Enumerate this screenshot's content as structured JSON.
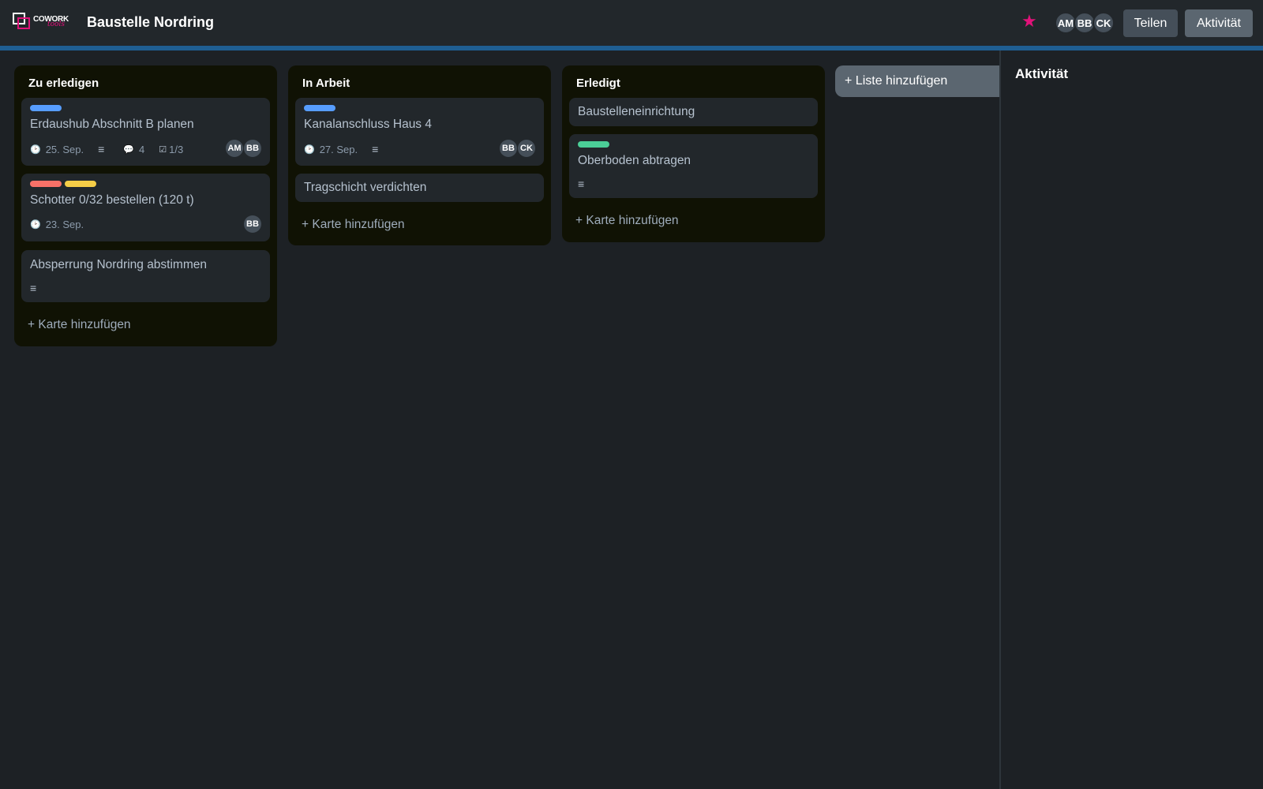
{
  "header": {
    "logo_text": "COWORK",
    "logo_sub": "tools",
    "board_title": "Baustelle Nordring",
    "star_icon": "star-icon",
    "members": [
      "AM",
      "BB",
      "CK"
    ],
    "share_label": "Teilen",
    "activity_label": "Aktivität"
  },
  "colors": {
    "accent": "#e2127a",
    "stripe": "#1f5e92",
    "label_blue": "#579dff",
    "label_red": "#f87168",
    "label_yellow": "#f5cd47",
    "label_green": "#4bce97"
  },
  "lists": [
    {
      "title": "Zu erledigen",
      "cards": [
        {
          "title": "Erdaushub Abschnitt B planen",
          "labels": [
            "blue"
          ],
          "due": "25. Sep.",
          "has_description": true,
          "comments": "4",
          "checklist": "1/3",
          "members": [
            "AM",
            "BB"
          ]
        },
        {
          "title": "Schotter 0/32 bestellen (120 t)",
          "labels": [
            "red",
            "yellow"
          ],
          "due": "23. Sep.",
          "members": [
            "BB"
          ]
        },
        {
          "title": "Absperrung Nordring abstimmen",
          "has_description": true
        }
      ],
      "add_card": "+ Karte hinzufügen"
    },
    {
      "title": "In Arbeit",
      "cards": [
        {
          "title": "Kanalanschluss Haus 4",
          "labels": [
            "blue"
          ],
          "due": "27. Sep.",
          "has_description": true,
          "members": [
            "BB",
            "CK"
          ]
        },
        {
          "title": "Tragschicht verdichten"
        }
      ],
      "add_card": "+ Karte hinzufügen"
    },
    {
      "title": "Erledigt",
      "cards": [
        {
          "title": "Baustelleneinrichtung"
        },
        {
          "title": "Oberboden abtragen",
          "labels": [
            "green"
          ],
          "has_description": true
        }
      ],
      "add_card": "+ Karte hinzufügen"
    }
  ],
  "add_list": "+ Liste hinzufügen",
  "activity_panel": {
    "title": "Aktivität"
  },
  "icons": {
    "clock": "clock-icon",
    "description": "description-icon",
    "comment": "comment-icon",
    "checklist": "checklist-icon"
  },
  "glyphs": {
    "clock": "🕑",
    "description": "≡",
    "comment": "💬",
    "checklist": "☑",
    "star": "★"
  }
}
